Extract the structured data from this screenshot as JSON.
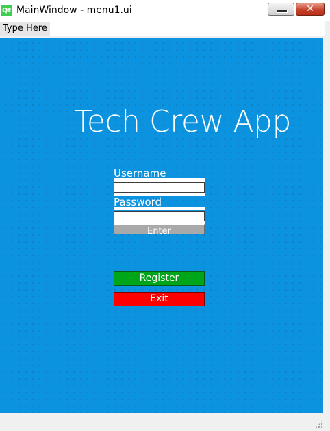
{
  "window": {
    "title": "MainWindow - menu1.ui",
    "logo_text": "Qt",
    "minimize_glyph": "",
    "close_glyph": "✕"
  },
  "menubar": {
    "items": [
      {
        "label": "Type Here"
      }
    ]
  },
  "form": {
    "app_title": "Tech Crew App",
    "username_label": "Username",
    "username_value": "",
    "password_label": "Password",
    "password_value": "",
    "enter_label": "Enter",
    "register_label": "Register",
    "exit_label": "Exit"
  },
  "colors": {
    "background": "#0b93e0",
    "register": "#00a61a",
    "exit": "#ff0000",
    "enter": "#a9a9a9",
    "qt_logo": "#41cd52"
  },
  "icons": {
    "logo": "qt-logo-icon",
    "minimize": "minimize-icon",
    "close": "close-icon",
    "grip": "size-grip-icon"
  }
}
